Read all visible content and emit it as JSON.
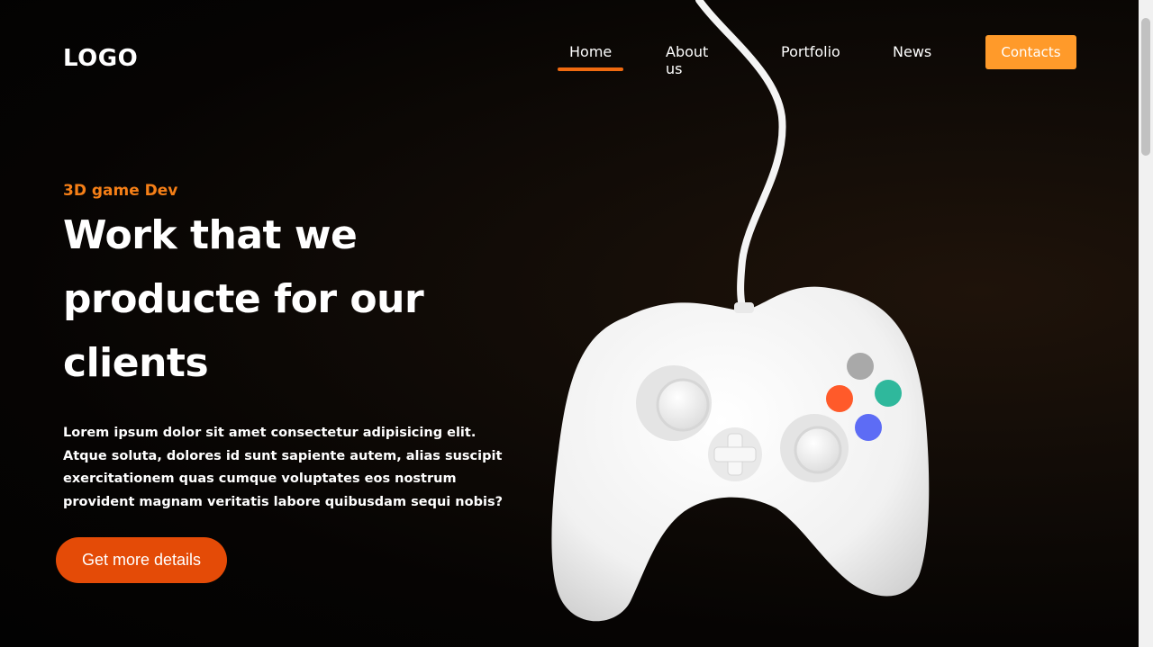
{
  "header": {
    "logo": "LOGO",
    "nav": [
      {
        "label": "Home",
        "active": true
      },
      {
        "label": "About us",
        "active": false
      },
      {
        "label": "Portfolio",
        "active": false
      },
      {
        "label": "News",
        "active": false
      }
    ],
    "contacts_label": "Contacts"
  },
  "hero": {
    "eyebrow": "3D game Dev",
    "title_lines": [
      "Work that we",
      "producte for our",
      "clients"
    ],
    "description": "Lorem ipsum dolor sit amet consectetur adipisicing elit. Atque soluta, dolores id sunt sapiente autem, alias suscipit exercitationem quas cumque voluptates eos nostrum provident magnam veritatis labore quibusdam sequi nobis?",
    "cta_label": "Get more details"
  },
  "illustration": {
    "icon": "gamepad-icon",
    "button_colors": [
      "#a9a9a9",
      "#ff5a2a",
      "#2fb89c",
      "#5d6cf5"
    ]
  },
  "colors": {
    "accent": "#f57f17",
    "nav_underline": "#f06a10",
    "contacts_bg": "#ff9a2a",
    "cta_bg": "#e44b07",
    "background": "#060403"
  }
}
